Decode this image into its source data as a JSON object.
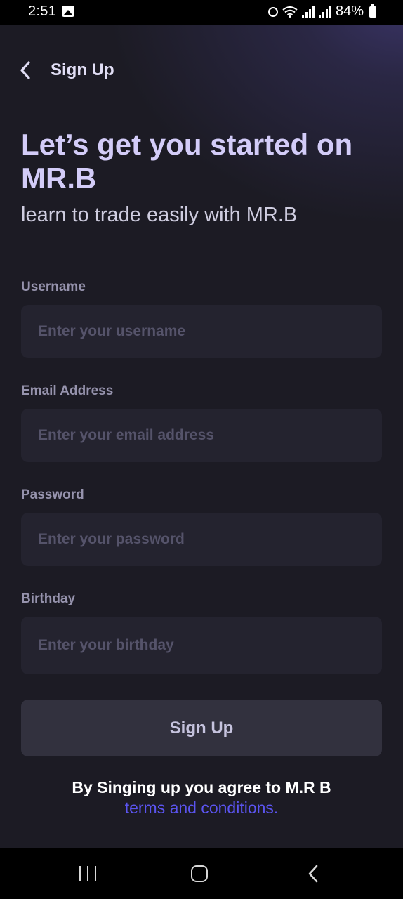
{
  "status_bar": {
    "time": "2:51",
    "battery": "84%",
    "icons": [
      "gallery-icon",
      "alarm-icon",
      "wifi-icon",
      "signal-icon",
      "signal-icon",
      "battery-icon"
    ]
  },
  "header": {
    "title": "Sign Up",
    "back_icon": "chevron-left-icon"
  },
  "hero": {
    "title": "Let’s get you started on MR.B",
    "subtitle": "learn to trade easily with MR.B"
  },
  "form": {
    "username": {
      "label": "Username",
      "placeholder": "Enter your username",
      "value": ""
    },
    "email": {
      "label": "Email Address",
      "placeholder": "Enter your email address",
      "value": ""
    },
    "password": {
      "label": "Password",
      "placeholder": "Enter your password",
      "value": ""
    },
    "birthday": {
      "label": "Birthday",
      "placeholder": "Enter your birthday",
      "value": ""
    },
    "submit_label": "Sign Up"
  },
  "terms": {
    "text": "By Singing up you agree to M.R B",
    "link": "terms and conditions."
  },
  "nav_bar": {
    "icons": [
      "recent-apps-icon",
      "home-icon",
      "back-icon"
    ]
  },
  "colors": {
    "background": "#1c1b24",
    "accent": "#5b54f0",
    "title": "#d3ccf8",
    "input_bg": "#24232f",
    "button_bg": "#32313e"
  }
}
